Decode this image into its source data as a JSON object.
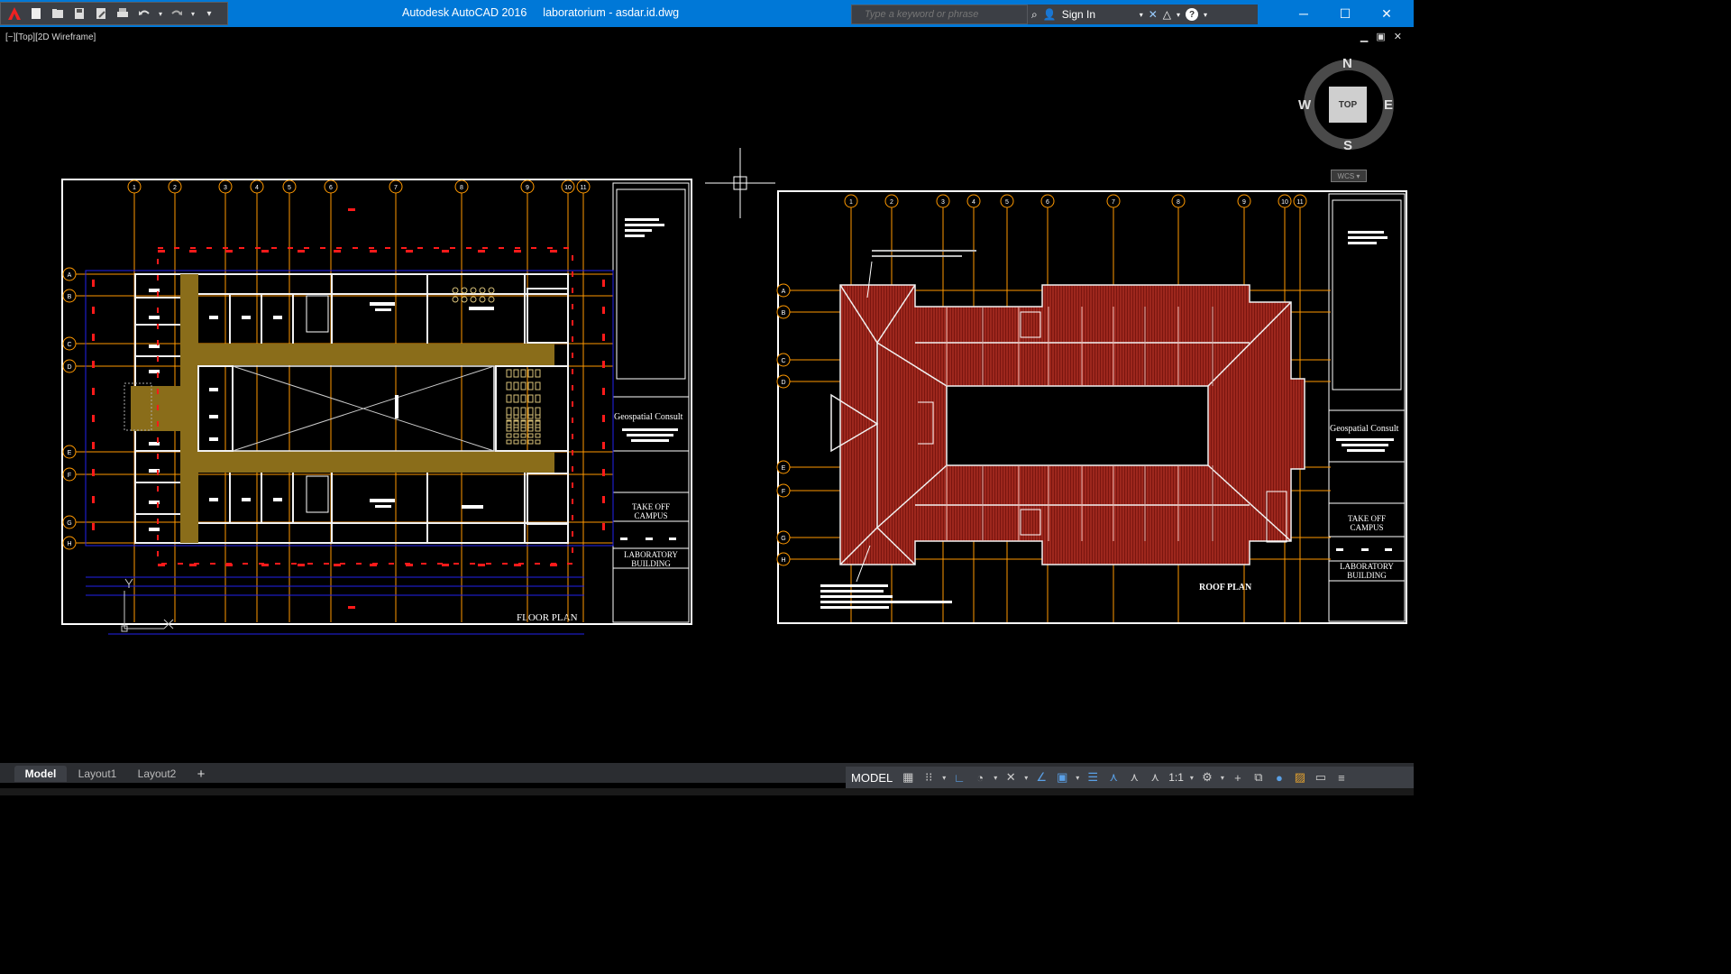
{
  "app": {
    "name": "Autodesk AutoCAD 2016",
    "file": "laboratorium - asdar.id.dwg"
  },
  "search": {
    "placeholder": "Type a keyword or phrase"
  },
  "account": {
    "signin_label": "Sign In"
  },
  "viewport": {
    "label": "[−][Top][2D Wireframe]"
  },
  "viewcube": {
    "north": "N",
    "south": "S",
    "east": "E",
    "west": "W",
    "face": "TOP",
    "wcs": "WCS"
  },
  "floor_plan": {
    "grid_columns": [
      "1",
      "2",
      "3",
      "4",
      "5",
      "6",
      "7",
      "8",
      "9",
      "10",
      "11"
    ],
    "grid_rows": [
      "A",
      "B",
      "C",
      "D",
      "E",
      "F",
      "G",
      "H"
    ],
    "title": "FLOOR PLAN",
    "company": "Geospatial Consult",
    "project_1": "TAKE OFF",
    "project_2": "CAMPUS",
    "building_1": "LABORATORY",
    "building_2": "BUILDING"
  },
  "roof_plan": {
    "title": "ROOF PLAN",
    "company": "Geospatial Consult",
    "project_1": "TAKE OFF",
    "project_2": "CAMPUS",
    "building_1": "LABORATORY",
    "building_2": "BUILDING"
  },
  "tabs": {
    "model": "Model",
    "layout1": "Layout1",
    "layout2": "Layout2",
    "add": "+"
  },
  "status": {
    "model": "MODEL",
    "scale": "1:1"
  },
  "colors": {
    "titlebar": "#0078d7",
    "grid": "#ff9900",
    "wall": "#f2f2f2",
    "corridor": "#8a6d1a",
    "roof": "#8b1c14",
    "dim": "#ff1a1a",
    "blue": "#2222ee"
  }
}
